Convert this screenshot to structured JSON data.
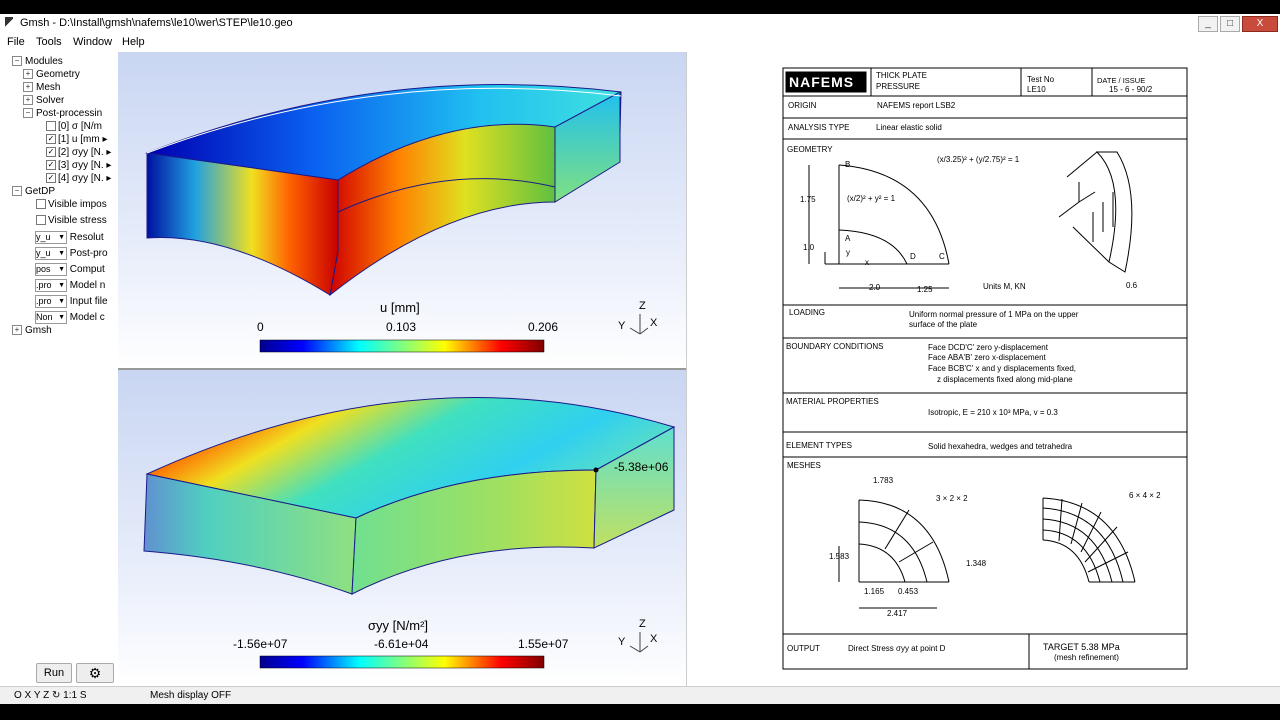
{
  "window": {
    "title": "Gmsh - D:\\Install\\gmsh\\nafems\\le10\\wer\\STEP\\le10.geo",
    "min": "_",
    "max": "□",
    "close": "X"
  },
  "menu": [
    "File",
    "Tools",
    "Window",
    "Help"
  ],
  "tree": {
    "modules": "Modules",
    "geometry": "Geometry",
    "mesh": "Mesh",
    "solver": "Solver",
    "post": "Post-processin",
    "views": [
      "[0] σ [N/m",
      "[1] u [mm",
      "[2] σyy [N.",
      "[3] σyy [N.",
      "[4] σyy [N."
    ],
    "getdp": "GetDP",
    "vis1": "Visible impos",
    "vis2": "Visible stress",
    "fields": [
      {
        "value": "y_u",
        "label": "Resolut"
      },
      {
        "value": "y_u",
        "label": "Post-pro"
      },
      {
        "value": "pos",
        "label": "Comput"
      },
      {
        "value": ".pro",
        "label": "Model n"
      },
      {
        "value": ".pro",
        "label": "Input file"
      },
      {
        "value": "Non",
        "label": "Model c"
      }
    ],
    "gmsh": "Gmsh"
  },
  "run_label": "Run",
  "gear_glyph": "⚙",
  "status": {
    "coords": "O X Y Z ↻ 1:1 S",
    "message": "Mesh display OFF"
  },
  "top_view": {
    "cbar_title": "u [mm]",
    "min": "0",
    "mid": "0.103",
    "max": "0.206",
    "axis_z": "Z",
    "axis_y": "Y",
    "axis_x": "X"
  },
  "bottom_view": {
    "cbar_title": "σyy [N/m²]",
    "min": "-1.56e+07",
    "mid": "-6.61e+04",
    "max": "1.55e+07",
    "probe": "-5.38e+06",
    "axis_z": "Z",
    "axis_y": "Y",
    "axis_x": "X"
  },
  "doc": {
    "logo": "NAFEMS",
    "title1": "THICK PLATE",
    "title2": "PRESSURE",
    "test_label": "Test No",
    "test_no": "LE10",
    "date_label": "DATE / ISSUE",
    "date": "15 - 6 - 90/2",
    "origin_label": "ORIGIN",
    "origin": "NAFEMS report LSB2",
    "analysis_label": "ANALYSIS TYPE",
    "analysis": "Linear elastic solid",
    "geometry_label": "GEOMETRY",
    "eq1": "(x/3.25)² + (y/2.75)² = 1",
    "eq2": "(x/2)² + y² = 1",
    "dim_175": "1.75",
    "dim_10": "1.0",
    "dim_20": "2.0",
    "dim_125": "1.25",
    "dim_06": "0.6",
    "units": "Units M, KN",
    "pts": [
      "B",
      "A",
      "D",
      "C",
      "x",
      "y"
    ],
    "loading_label": "LOADING",
    "loading1": "Uniform normal pressure of 1 MPa on the upper",
    "loading2": "surface of the plate",
    "bc_label": "BOUNDARY CONDITIONS",
    "bc1": "Face DCD'C' zero y-displacement",
    "bc2": "Face ABA'B' zero x-displacement",
    "bc3": "Face BCB'C' x and y displacements fixed,",
    "bc4": "z displacements fixed along mid-plane",
    "mat_label": "MATERIAL PROPERTIES",
    "mat": "Isotropic, E = 210 x 10³ MPa,    v = 0.3",
    "elem_label": "ELEMENT TYPES",
    "elem": "Solid hexahedra, wedges and tetrahedra",
    "meshes_label": "MESHES",
    "mesh1": "3 × 2 × 2",
    "mesh2": "6 × 4 × 2",
    "m_1783": "1.783",
    "m_1583": "1.583",
    "m_1348": "1.348",
    "m_1165": "1.165",
    "m_0453": "0.453",
    "m_2417": "2.417",
    "output_label": "OUTPUT",
    "output": "Direct Stress σyy at point D",
    "target_label": "TARGET  5.38  MPa",
    "target_note": "(mesh refinement)"
  }
}
